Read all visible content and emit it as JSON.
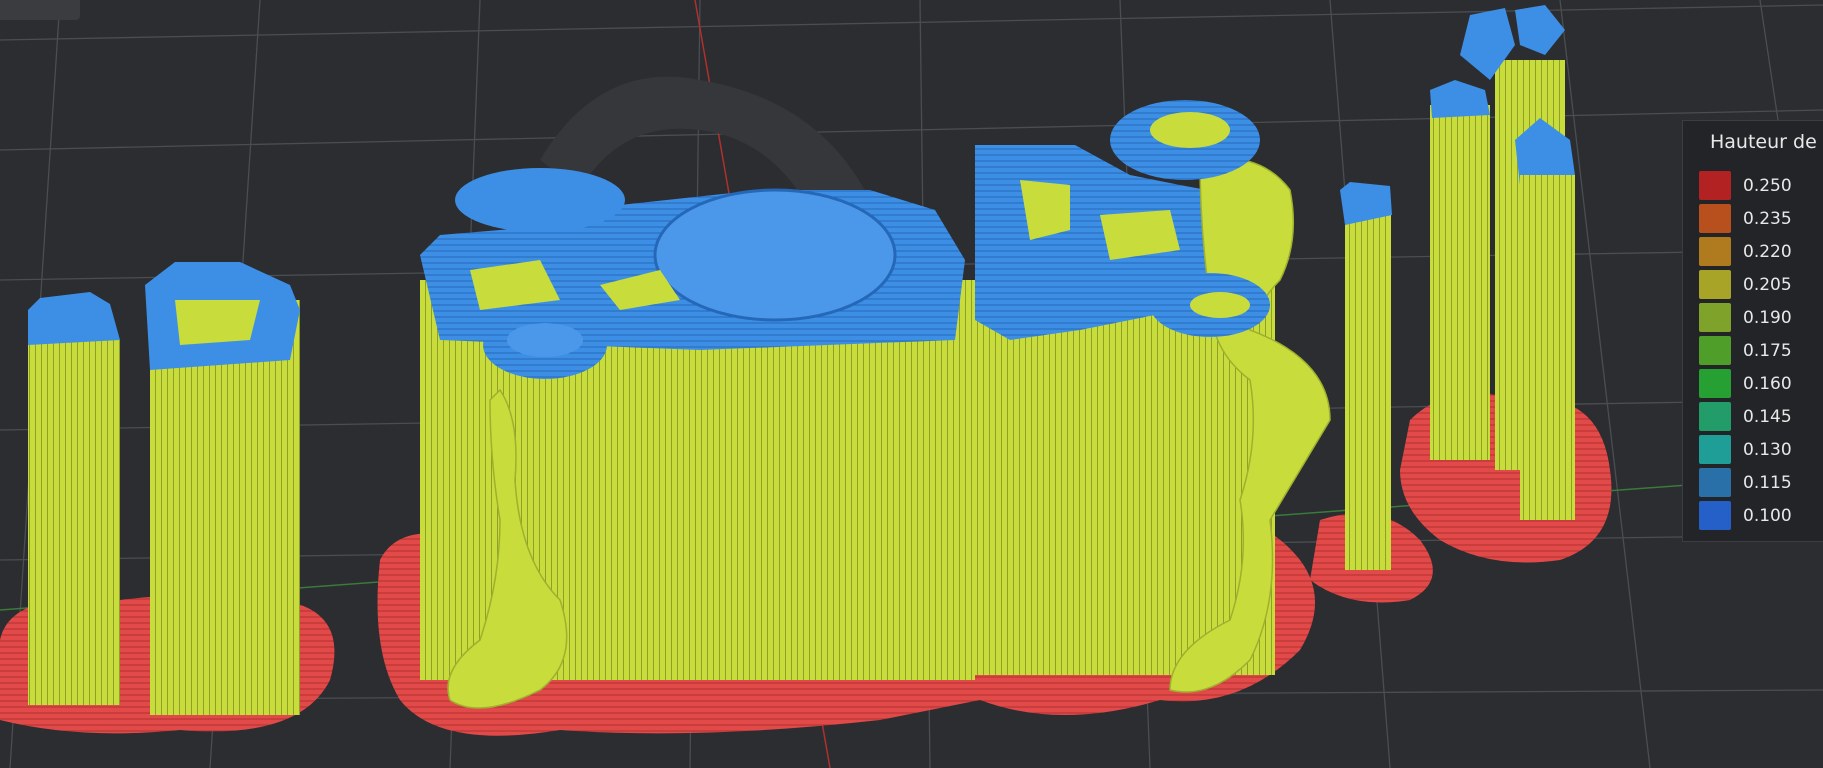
{
  "viewer": {
    "objects_color_top": "#3d8fe6",
    "objects_color_wall": "#c8dc3c",
    "brim_color": "#e24a4a",
    "background": "#2b2d30"
  },
  "legend": {
    "title": "Hauteur de c",
    "items": [
      {
        "value": "0.250",
        "color": "#b22222"
      },
      {
        "value": "0.235",
        "color": "#b8501e"
      },
      {
        "value": "0.220",
        "color": "#b07a1e"
      },
      {
        "value": "0.205",
        "color": "#a8a428"
      },
      {
        "value": "0.190",
        "color": "#7ea22a"
      },
      {
        "value": "0.175",
        "color": "#4f9e2a"
      },
      {
        "value": "0.160",
        "color": "#26a032"
      },
      {
        "value": "0.145",
        "color": "#229c68"
      },
      {
        "value": "0.130",
        "color": "#1f9e98"
      },
      {
        "value": "0.115",
        "color": "#2a70a8"
      },
      {
        "value": "0.100",
        "color": "#2460c8"
      }
    ]
  }
}
